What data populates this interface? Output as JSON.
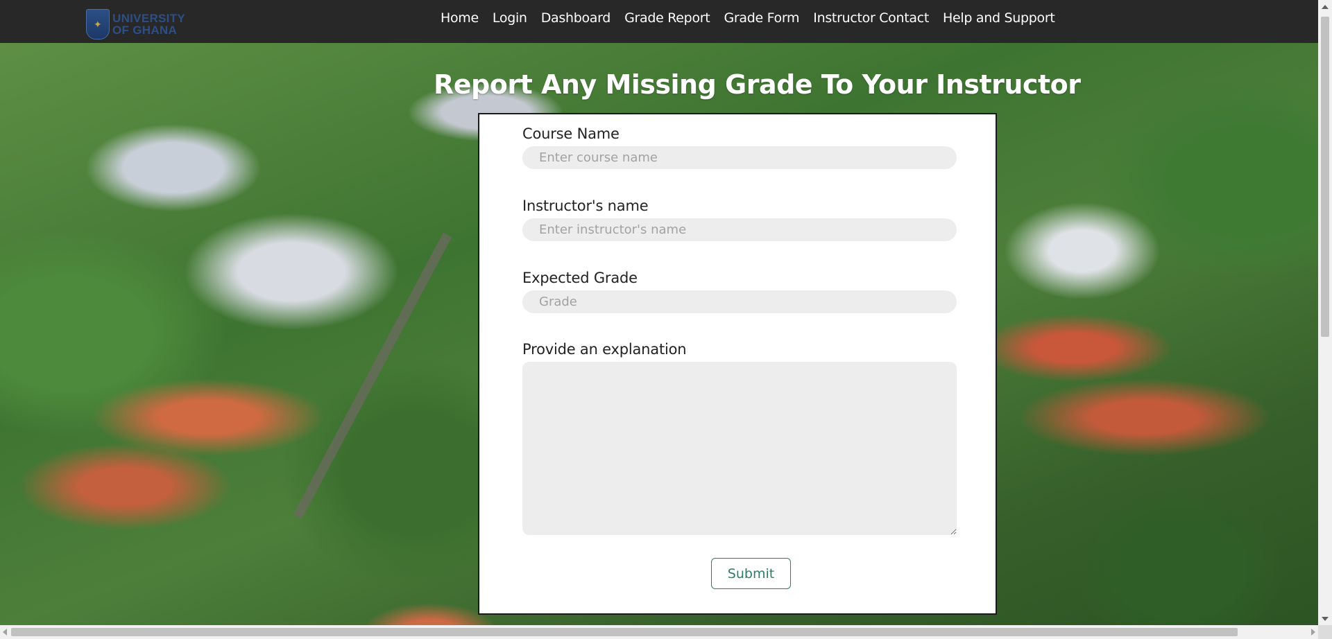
{
  "brand": {
    "logo_line1": "UNIVERSITY",
    "logo_line2": "OF GHANA",
    "logo_icon": "crest-icon"
  },
  "nav": {
    "items": [
      {
        "label": "Home"
      },
      {
        "label": "Login"
      },
      {
        "label": "Dashboard"
      },
      {
        "label": "Grade Report"
      },
      {
        "label": "Grade Form"
      },
      {
        "label": "Instructor Contact"
      },
      {
        "label": "Help and Support"
      }
    ]
  },
  "page": {
    "title": "Report Any Missing Grade To Your Instructor"
  },
  "form": {
    "course_name": {
      "label": "Course Name",
      "placeholder": "Enter course name",
      "value": ""
    },
    "instructor_name": {
      "label": "Instructor's name",
      "placeholder": "Enter instructor's name",
      "value": ""
    },
    "expected_grade": {
      "label": "Expected Grade",
      "placeholder": "Grade",
      "value": ""
    },
    "explanation": {
      "label": "Provide an explanation",
      "value": ""
    },
    "submit_label": "Submit"
  },
  "colors": {
    "navbar": "#282828",
    "accent": "#2e7d62",
    "input_bg": "#ededed"
  }
}
